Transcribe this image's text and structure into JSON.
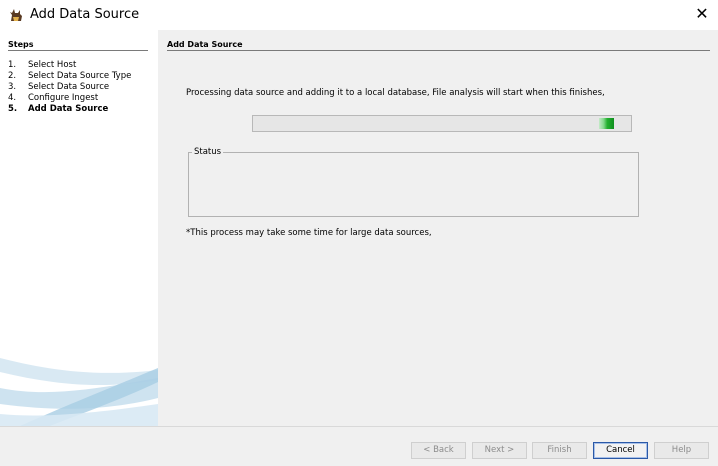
{
  "window": {
    "title": "Add Data Source",
    "app_icon": "autopsy-dog-icon",
    "close_glyph": "✕"
  },
  "steps": {
    "title": "Steps",
    "items": [
      {
        "num": "1.",
        "label": "Select Host"
      },
      {
        "num": "2.",
        "label": "Select Data Source Type"
      },
      {
        "num": "3.",
        "label": "Select Data Source"
      },
      {
        "num": "4.",
        "label": "Configure Ingest"
      },
      {
        "num": "5.",
        "label": "Add Data Source"
      }
    ],
    "current_index": 4
  },
  "main": {
    "title": "Add Data Source",
    "message": "Processing data source and adding it to a local database, File analysis will start when this finishes,",
    "progress": {
      "indeterminate": true,
      "indicator_position_fraction": 0.935,
      "color": "#23b02f"
    },
    "status_label": "Status",
    "status_text": "",
    "note": "*This process may take some time for large data sources,"
  },
  "buttons": {
    "back": {
      "label": "< Back",
      "enabled": false
    },
    "next": {
      "label": "Next >",
      "enabled": false
    },
    "finish": {
      "label": "Finish",
      "enabled": false
    },
    "cancel": {
      "label": "Cancel",
      "enabled": true
    },
    "help": {
      "label": "Help",
      "enabled": false
    }
  }
}
